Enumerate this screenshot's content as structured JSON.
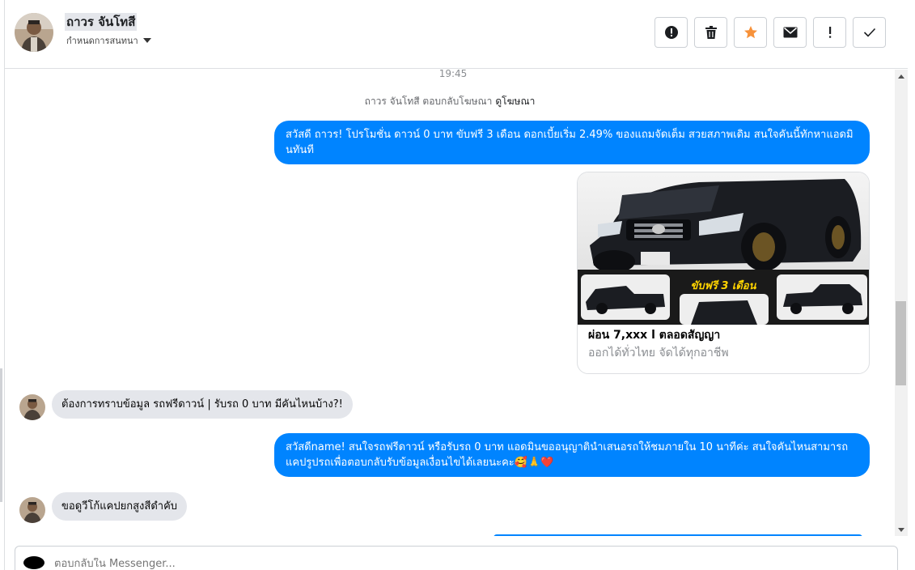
{
  "header": {
    "contact_name": "ถาวร จันโทสี",
    "conversation_status": "กำหนดการสนทนา",
    "actions": [
      {
        "icon": "alert-circle-icon",
        "label": "spam"
      },
      {
        "icon": "trash-icon",
        "label": "delete"
      },
      {
        "icon": "star-icon",
        "label": "star"
      },
      {
        "icon": "envelope-icon",
        "label": "unread"
      },
      {
        "icon": "exclamation-icon",
        "label": "follow-up"
      },
      {
        "icon": "check-icon",
        "label": "done"
      }
    ]
  },
  "chat": {
    "timestamp": "19:45",
    "ad_reply_prefix": "ถาวร จันโทสี ตอบกลับโฆษณา",
    "ad_reply_link": "ดูโฆษณา",
    "messages": [
      {
        "direction": "out",
        "text": "สวัสดี ถาวร! โปรโมชั่น ดาวน์ 0 บาท ขับฟรี 3 เดือน ดอกเบี้ยเริ่ม 2.49% ของแถมจัดเต็ม สวยสภาพเดิม สนใจคันนี้ทักหาแอดมินทันที"
      },
      {
        "direction": "in",
        "text": "ต้องการทราบข้อมูล รถฟรีดาวน์ | รับรถ 0 บาท มีคันไหนบ้าง?!"
      },
      {
        "direction": "out",
        "text": "สวัสดีname! สนใจรถฟรีดาวน์ หรือรับรถ 0 บาท แอดมินขออนุญาตินำเสนอรถให้ชมภายใน 10 นาทีค่ะ สนใจคันไหนสามารถแคปรูปรถเพื่อตอบกลับรับข้อมูลเงื่อนไขได้เลยนะคะ🥰🙏❤️"
      },
      {
        "direction": "in",
        "text": "ขอดูวีโก้แคปยกสูงสีดำคับ"
      }
    ],
    "ad_card": {
      "banner_text": "ขับฟรี 3 เดือน",
      "title": "ผ่อน 7,xxx l ตลอดสัญญา",
      "subtitle": "ออกได้ทั่วไทย จัดได้ทุกอาชีพ"
    }
  },
  "composer": {
    "placeholder": "ตอบกลับใน Messenger..."
  },
  "colors": {
    "outgoing_bubble": "#0084ff",
    "incoming_bubble": "#e4e6eb",
    "star_accent": "#f7923a"
  }
}
